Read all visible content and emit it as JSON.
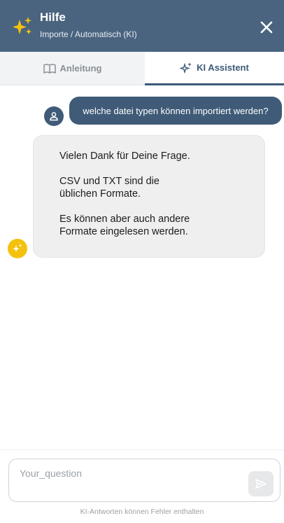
{
  "header": {
    "title": "Hilfe",
    "subtitle": "Importe / Automatisch (KI)",
    "icon": "sparkles-icon",
    "close_icon": "close-icon"
  },
  "tabs": [
    {
      "label": "Anleitung",
      "icon": "book-icon",
      "active": false
    },
    {
      "label": "KI Assistent",
      "icon": "sparkles-icon",
      "active": true
    }
  ],
  "conversation": {
    "user_message": "welche datei typen können importiert werden?",
    "ai_message": {
      "line1": "Vielen Dank für Deine Frage.",
      "line2a": "CSV und TXT sind die",
      "line2b": "üblichen Formate.",
      "line3a": "Es können aber auch andere",
      "line3b": "Formate eingelesen werden."
    }
  },
  "input": {
    "placeholder": "Your_question",
    "value": "",
    "send_icon": "send-icon"
  },
  "disclaimer": "KI-Antworten können Fehler enthalten",
  "colors": {
    "header_bg": "#4a6480",
    "accent": "#3d5a78",
    "sparkle_gold": "#f4c20d",
    "ai_bubble_bg": "#efefef"
  }
}
